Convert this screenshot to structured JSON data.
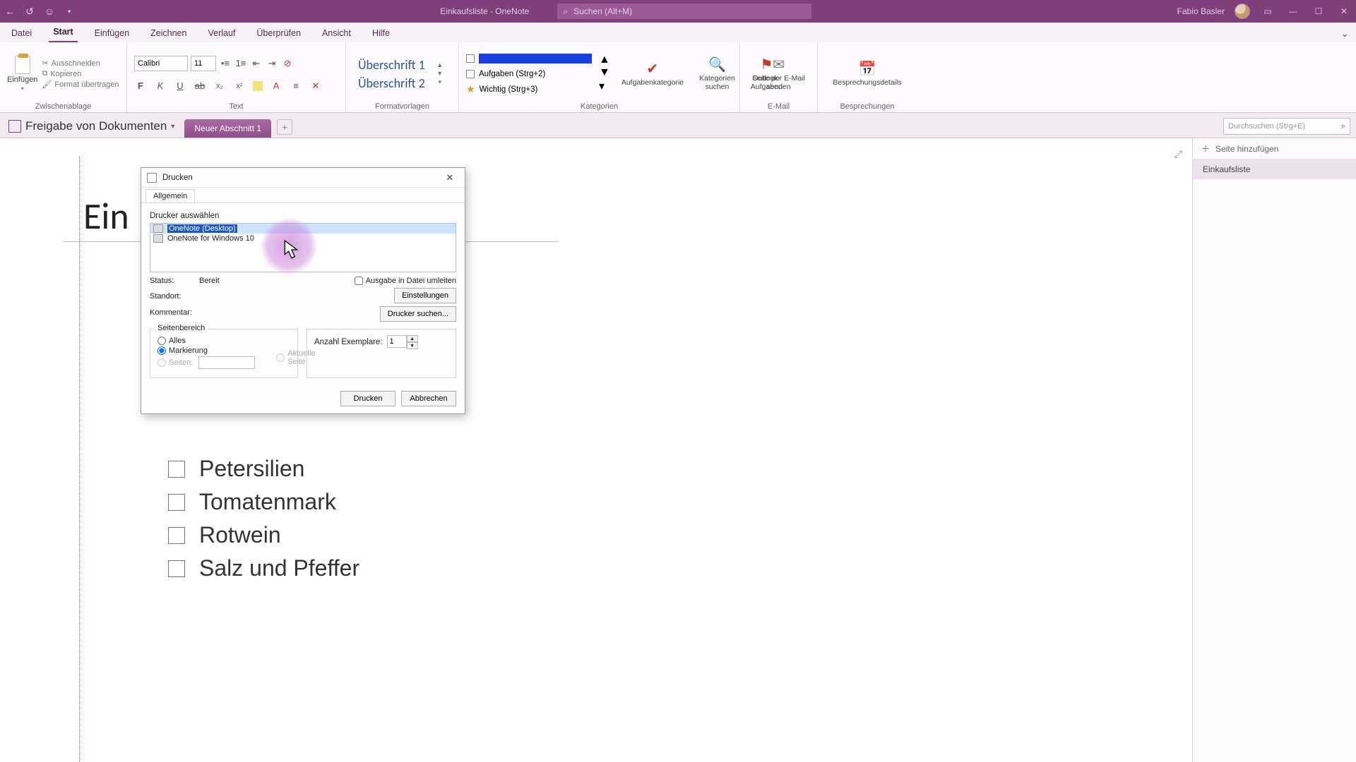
{
  "titlebar": {
    "doc_title": "Einkaufsliste - OneNote",
    "search_placeholder": "Suchen (Alt+M)",
    "user_name": "Fabio Basler"
  },
  "menu": {
    "file": "Datei",
    "home": "Start",
    "insert": "Einfügen",
    "draw": "Zeichnen",
    "history": "Verlauf",
    "review": "Überprüfen",
    "view": "Ansicht",
    "help": "Hilfe"
  },
  "ribbon": {
    "paste_label": "Einfügen",
    "clip": {
      "cut": "Ausschneiden",
      "copy": "Kopieren",
      "format_painter": "Format übertragen"
    },
    "group_clipboard": "Zwischenablage",
    "font_name": "Calibri",
    "font_size": "11",
    "group_text": "Text",
    "style1": "Überschrift 1",
    "style2": "Überschrift 2",
    "group_styles": "Formatvorlagen",
    "tag_todo_blue": "",
    "tag_tasks": "Aufgaben (Strg+2)",
    "tag_important": "Wichtig (Strg+3)",
    "btn_task_category": "Aufgabenkategorie",
    "btn_find_tags": "Kategorien suchen",
    "btn_outlook_tasks": "Outlook-Aufgaben",
    "group_tags": "Kategorien",
    "btn_email_page": "Seite per E-Mail senden",
    "group_email": "E-Mail",
    "btn_meeting_details": "Besprechungsdetails",
    "group_meetings": "Besprechungen"
  },
  "notebook": {
    "name": "Freigabe von Dokumenten",
    "section": "Neuer Abschnitt 1",
    "search_placeholder": "Durchsuchen (Strg+E)"
  },
  "page": {
    "title_visible": "Ein",
    "items": [
      "Petersilien",
      "Tomatenmark",
      "Rotwein",
      "Salz und Pfeffer"
    ]
  },
  "pagepanel": {
    "add_page": "Seite hinzufügen",
    "page1": "Einkaufsliste"
  },
  "dialog": {
    "title": "Drucken",
    "tab_general": "Allgemein",
    "lbl_select_printer": "Drucker auswählen",
    "printers": [
      "OneNote (Desktop)",
      "OneNote for Windows 10"
    ],
    "lbl_status": "Status:",
    "val_status": "Bereit",
    "lbl_location": "Standort:",
    "lbl_comment": "Kommentar:",
    "chk_to_file": "Ausgabe in Datei umleiten",
    "btn_prefs": "Einstellungen",
    "btn_find_printer": "Drucker suchen...",
    "group_range": "Seitenbereich",
    "radio_all": "Alles",
    "radio_selection": "Markierung",
    "radio_current": "Aktuelle Seite",
    "radio_pages": "Seiten:",
    "lbl_copies": "Anzahl Exemplare:",
    "val_copies": "1",
    "btn_print": "Drucken",
    "btn_cancel": "Abbrechen"
  }
}
